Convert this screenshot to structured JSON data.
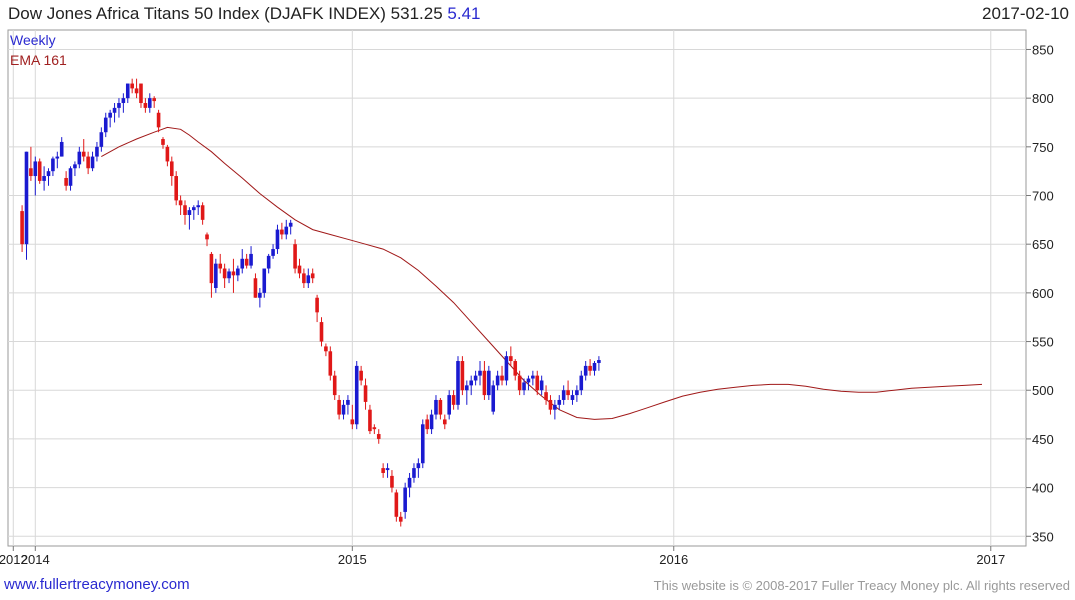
{
  "header": {
    "title": "Dow Jones Africa Titans 50 Index (DJAFK INDEX)",
    "last": "531.25",
    "change": "5.41",
    "date": "2017-02-10"
  },
  "legend": {
    "weekly": "Weekly",
    "ema": "EMA 161"
  },
  "footer": {
    "url": "www.fullertreacymoney.com",
    "copyright": "This website is © 2008-2017 Fuller Treacy Money plc. All rights reserved"
  },
  "colors": {
    "up": "#1a1ad0",
    "down": "#e01818",
    "ema": "#a01818",
    "grid": "#d8d8d8"
  },
  "chart_data": {
    "type": "candlestick",
    "frequency": "weekly",
    "ylim": [
      340,
      870
    ],
    "yticks": [
      350,
      400,
      450,
      500,
      550,
      600,
      650,
      700,
      750,
      800,
      850
    ],
    "xticks": [
      {
        "label": "2012",
        "week": -2
      },
      {
        "label": "2014",
        "week": 3
      },
      {
        "label": "2015",
        "week": 75
      },
      {
        "label": "2016",
        "week": 148
      },
      {
        "label": "2017",
        "week": 220
      }
    ],
    "week_range": [
      -3.2,
      228
    ],
    "candles": [
      [
        684,
        690,
        642,
        650
      ],
      [
        650,
        745,
        634,
        745
      ],
      [
        728,
        750,
        715,
        720
      ],
      [
        720,
        740,
        700,
        735
      ],
      [
        735,
        738,
        712,
        715
      ],
      [
        715,
        730,
        705,
        720
      ],
      [
        720,
        728,
        710,
        725
      ],
      [
        725,
        740,
        720,
        738
      ],
      [
        738,
        745,
        728,
        740
      ],
      [
        740,
        760,
        740,
        755
      ],
      [
        718,
        725,
        705,
        710
      ],
      [
        710,
        730,
        705,
        728
      ],
      [
        728,
        735,
        720,
        732
      ],
      [
        732,
        750,
        728,
        745
      ],
      [
        745,
        758,
        735,
        740
      ],
      [
        740,
        745,
        722,
        728
      ],
      [
        728,
        745,
        725,
        740
      ],
      [
        740,
        755,
        735,
        750
      ],
      [
        750,
        770,
        745,
        765
      ],
      [
        765,
        785,
        760,
        780
      ],
      [
        780,
        788,
        770,
        785
      ],
      [
        785,
        795,
        775,
        790
      ],
      [
        790,
        800,
        780,
        795
      ],
      [
        795,
        805,
        785,
        800
      ],
      [
        800,
        815,
        795,
        815
      ],
      [
        815,
        820,
        805,
        810
      ],
      [
        810,
        820,
        800,
        805
      ],
      [
        815,
        815,
        790,
        795
      ],
      [
        795,
        800,
        785,
        790
      ],
      [
        790,
        805,
        785,
        800
      ],
      [
        800,
        802,
        790,
        797
      ],
      [
        785,
        788,
        765,
        770
      ],
      [
        758,
        760,
        748,
        752
      ],
      [
        750,
        752,
        730,
        735
      ],
      [
        735,
        740,
        710,
        720
      ],
      [
        720,
        725,
        690,
        695
      ],
      [
        695,
        700,
        680,
        690
      ],
      [
        690,
        695,
        670,
        680
      ],
      [
        680,
        688,
        665,
        685
      ],
      [
        685,
        690,
        675,
        688
      ],
      [
        688,
        695,
        680,
        690
      ],
      [
        690,
        693,
        670,
        675
      ],
      [
        660,
        662,
        648,
        655
      ],
      [
        640,
        642,
        595,
        610
      ],
      [
        605,
        635,
        600,
        630
      ],
      [
        630,
        640,
        620,
        625
      ],
      [
        625,
        630,
        605,
        615
      ],
      [
        615,
        625,
        610,
        622
      ],
      [
        622,
        635,
        600,
        618
      ],
      [
        618,
        628,
        612,
        625
      ],
      [
        625,
        645,
        620,
        635
      ],
      [
        635,
        640,
        625,
        628
      ],
      [
        628,
        648,
        625,
        640
      ],
      [
        615,
        620,
        595,
        595
      ],
      [
        595,
        605,
        585,
        600
      ],
      [
        600,
        625,
        595,
        625
      ],
      [
        625,
        640,
        620,
        638
      ],
      [
        638,
        650,
        635,
        645
      ],
      [
        645,
        670,
        640,
        665
      ],
      [
        665,
        672,
        655,
        660
      ],
      [
        660,
        675,
        655,
        668
      ],
      [
        668,
        675,
        660,
        672
      ],
      [
        650,
        655,
        620,
        625
      ],
      [
        628,
        635,
        615,
        620
      ],
      [
        620,
        625,
        605,
        610
      ],
      [
        610,
        625,
        605,
        618
      ],
      [
        620,
        625,
        610,
        615
      ],
      [
        595,
        598,
        570,
        580
      ],
      [
        570,
        575,
        545,
        550
      ],
      [
        545,
        548,
        535,
        540
      ],
      [
        540,
        545,
        510,
        515
      ],
      [
        515,
        520,
        490,
        495
      ],
      [
        490,
        495,
        470,
        475
      ],
      [
        475,
        490,
        470,
        485
      ],
      [
        485,
        495,
        475,
        490
      ],
      [
        470,
        485,
        460,
        465
      ],
      [
        465,
        530,
        460,
        525
      ],
      [
        520,
        525,
        505,
        510
      ],
      [
        505,
        512,
        480,
        488
      ],
      [
        480,
        485,
        455,
        458
      ],
      [
        462,
        465,
        455,
        460
      ],
      [
        455,
        460,
        445,
        450
      ],
      [
        420,
        425,
        410,
        415
      ],
      [
        418,
        425,
        410,
        420
      ],
      [
        412,
        418,
        395,
        400
      ],
      [
        395,
        398,
        365,
        370
      ],
      [
        370,
        375,
        360,
        365
      ],
      [
        375,
        405,
        368,
        400
      ],
      [
        400,
        415,
        390,
        410
      ],
      [
        410,
        425,
        405,
        420
      ],
      [
        420,
        430,
        410,
        425
      ],
      [
        425,
        470,
        420,
        465
      ],
      [
        470,
        475,
        455,
        460
      ],
      [
        460,
        480,
        455,
        475
      ],
      [
        475,
        495,
        470,
        490
      ],
      [
        490,
        492,
        470,
        475
      ],
      [
        470,
        475,
        460,
        465
      ],
      [
        475,
        500,
        470,
        495
      ],
      [
        495,
        500,
        480,
        485
      ],
      [
        485,
        535,
        480,
        530
      ],
      [
        530,
        535,
        495,
        500
      ],
      [
        500,
        510,
        485,
        505
      ],
      [
        505,
        515,
        495,
        510
      ],
      [
        510,
        520,
        505,
        515
      ],
      [
        515,
        530,
        505,
        520
      ],
      [
        520,
        530,
        490,
        495
      ],
      [
        495,
        525,
        490,
        520
      ],
      [
        478,
        510,
        475,
        505
      ],
      [
        505,
        520,
        500,
        515
      ],
      [
        515,
        525,
        505,
        510
      ],
      [
        510,
        540,
        505,
        535
      ],
      [
        535,
        545,
        525,
        530
      ],
      [
        530,
        532,
        510,
        515
      ],
      [
        515,
        520,
        495,
        500
      ],
      [
        500,
        512,
        495,
        508
      ],
      [
        508,
        515,
        500,
        512
      ],
      [
        512,
        520,
        505,
        515
      ],
      [
        515,
        520,
        495,
        500
      ],
      [
        500,
        515,
        495,
        510
      ],
      [
        498,
        505,
        485,
        490
      ],
      [
        490,
        495,
        475,
        480
      ],
      [
        480,
        490,
        470,
        485
      ],
      [
        485,
        495,
        480,
        490
      ],
      [
        490,
        505,
        485,
        500
      ],
      [
        500,
        510,
        490,
        495
      ],
      [
        490,
        500,
        485,
        495
      ],
      [
        495,
        505,
        488,
        500
      ],
      [
        500,
        520,
        495,
        515
      ],
      [
        515,
        530,
        510,
        525
      ],
      [
        525,
        532,
        515,
        520
      ],
      [
        520,
        530,
        515,
        528
      ],
      [
        528,
        535,
        520,
        531
      ]
    ],
    "ema": [
      [
        18,
        740
      ],
      [
        22,
        750
      ],
      [
        26,
        758
      ],
      [
        30,
        765
      ],
      [
        33,
        770
      ],
      [
        36,
        768
      ],
      [
        38,
        762
      ],
      [
        40,
        755
      ],
      [
        43,
        745
      ],
      [
        46,
        733
      ],
      [
        50,
        718
      ],
      [
        54,
        702
      ],
      [
        58,
        688
      ],
      [
        62,
        675
      ],
      [
        66,
        665
      ],
      [
        70,
        660
      ],
      [
        74,
        655
      ],
      [
        78,
        650
      ],
      [
        82,
        645
      ],
      [
        86,
        636
      ],
      [
        90,
        623
      ],
      [
        94,
        607
      ],
      [
        98,
        590
      ],
      [
        102,
        570
      ],
      [
        106,
        550
      ],
      [
        110,
        530
      ],
      [
        114,
        510
      ],
      [
        118,
        494
      ],
      [
        122,
        480
      ],
      [
        126,
        472
      ],
      [
        130,
        470
      ],
      [
        134,
        471
      ],
      [
        138,
        476
      ],
      [
        142,
        482
      ],
      [
        146,
        488
      ],
      [
        150,
        494
      ],
      [
        154,
        498
      ],
      [
        158,
        501
      ],
      [
        162,
        503
      ],
      [
        166,
        505
      ],
      [
        170,
        506
      ],
      [
        174,
        506
      ],
      [
        178,
        504
      ],
      [
        182,
        501
      ],
      [
        186,
        499
      ],
      [
        190,
        498
      ],
      [
        194,
        498
      ],
      [
        198,
        500
      ],
      [
        202,
        502
      ],
      [
        206,
        503
      ],
      [
        210,
        504
      ],
      [
        214,
        505
      ],
      [
        218,
        506
      ]
    ]
  }
}
